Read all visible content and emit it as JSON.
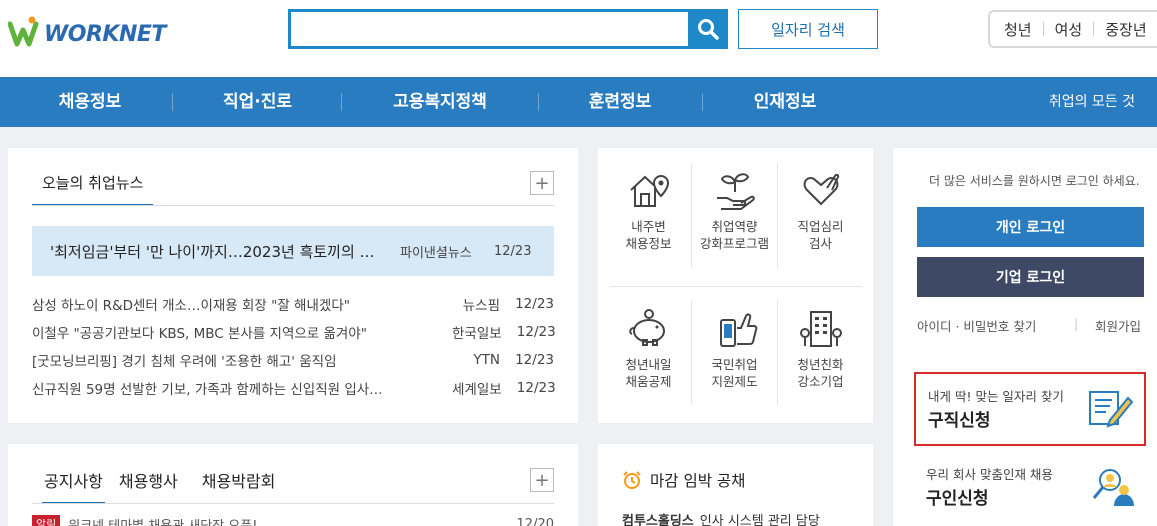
{
  "logo": {
    "text": "WORKNET",
    "colors": {
      "w_green": "#5fb23a",
      "text_blue": "#2b6ab0",
      "accent_orange": "#f39a1e"
    }
  },
  "search": {
    "value": "",
    "placeholder": "",
    "icon": "search-icon",
    "job_search_label": "일자리 검색"
  },
  "target_tabs": [
    "청년",
    "여성",
    "중장년"
  ],
  "gnb": {
    "items": [
      "채용정보",
      "직업·진로",
      "고용복지정책",
      "훈련정보",
      "인재정보"
    ],
    "all_label": "취업의 모든 것"
  },
  "news": {
    "tab": "오늘의 취업뉴스",
    "more_label": "+",
    "headline": {
      "title": "'최저임금'부터 '만 나이'까지…2023년 흑토끼의 …",
      "source": "파이낸셜뉴스",
      "date": "12/23"
    },
    "items": [
      {
        "title": "삼성 하노이 R&D센터 개소…이재용 회장 \"잘 해내겠다\"",
        "source": "뉴스핌",
        "date": "12/23"
      },
      {
        "title": "이철우 \"공공기관보다 KBS, MBC 본사를 지역으로 옮겨야\"",
        "source": "한국일보",
        "date": "12/23"
      },
      {
        "title": "[굿모닝브리핑] 경기 침체 우려에 '조용한 해고' 움직임",
        "source": "YTN",
        "date": "12/23"
      },
      {
        "title": "신규직원 59명 선발한 기보, 가족과 함께하는 신입직원 입사…",
        "source": "세계일보",
        "date": "12/23"
      }
    ]
  },
  "notice": {
    "tabs": [
      "공지사항",
      "채용행사",
      "채용박람회"
    ],
    "more_label": "+",
    "first_row": {
      "badge": "알림",
      "title": "워크넷 테마별 채용관 새단장 오픈!",
      "date": "12/20"
    }
  },
  "services": [
    {
      "icon": "house-map-pin-icon",
      "line1": "내주변",
      "line2": "채용정보"
    },
    {
      "icon": "plant-hand-icon",
      "line1": "취업역량",
      "line2": "강화프로그램"
    },
    {
      "icon": "heart-hand-icon",
      "line1": "직업심리",
      "line2": "검사"
    },
    {
      "icon": "piggy-bank-icon",
      "line1": "청년내일",
      "line2": "채움공제"
    },
    {
      "icon": "thumbs-up-phone-icon",
      "line1": "국민취업",
      "line2": "지원제도"
    },
    {
      "icon": "building-icon",
      "line1": "청년친화",
      "line2": "강소기업"
    }
  ],
  "deadline": {
    "title": "마감 임박 공채",
    "icon": "alarm-clock-icon",
    "first_row": {
      "company": "컴투스홀딩스",
      "title": "인사 시스템 관리 담당"
    }
  },
  "login": {
    "hint": "더 많은 서비스를 원하시면 로그인 하세요.",
    "person_label": "개인 로그인",
    "corp_label": "기업 로그인",
    "find_label": "아이디 · 비밀번호 찾기",
    "join_label": "회원가입",
    "colors": {
      "person": "#2a7cc0",
      "corp": "#3e4a65",
      "highlight": "#d82a2a"
    }
  },
  "job_cards": [
    {
      "sub": "내게 딱! 맞는 일자리 찾기",
      "main": "구직신청",
      "icon": "resume-pencil-icon"
    },
    {
      "sub": "우리 회사 맞춤인재 채용",
      "main": "구인신청",
      "icon": "person-search-icon"
    }
  ]
}
